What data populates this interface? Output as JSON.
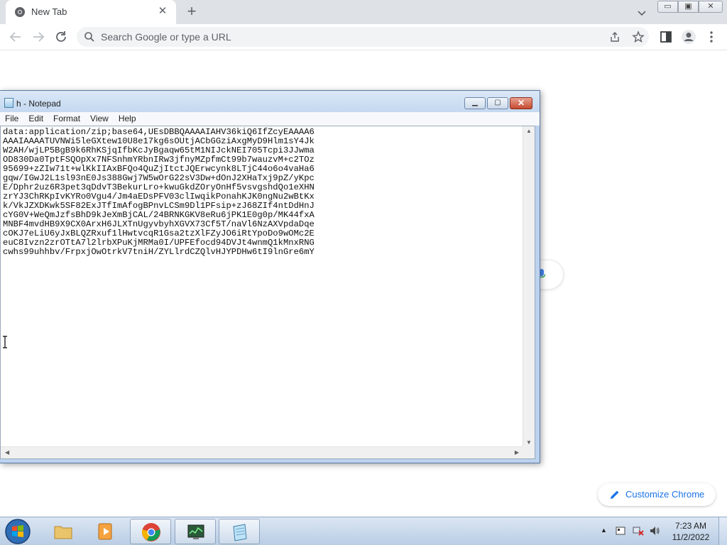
{
  "browser": {
    "tab_title": "New Tab",
    "tab_close": "✕",
    "new_tab_label": "+",
    "omnibox_placeholder": "Search Google or type a URL",
    "customize_label": "Customize Chrome"
  },
  "window_controls": {
    "minimize": "▭",
    "restore": "▣",
    "close": "✕"
  },
  "notepad": {
    "title": "h - Notepad",
    "menu": [
      "File",
      "Edit",
      "Format",
      "View",
      "Help"
    ],
    "content": "data:application/zip;base64,UEsDBBQAAAAIAHV36kiQ6IfZcyEAAAA6\nAAAIAAAATUVNWi5leGXtew10U8e17kg6sOUtjACbGGziAxgMyD9Hlm1sY4Jk\nW2AH/wjLP5BgB9k6RhKSjqIfbKcJyBgaqw65tM1NIJckNEI705Tcpi3JJwma\nOD830Da0TptFSQOpXx7NFSnhmYRbnIRw3jfnyMZpfmCt99b7wauzvM+c2TOz\n95699+zZIw71t+wlKkIIAxBFQo4QuZjItctJQErwcynk8LTjC44o6o4vaHa6\ngqw/IGwJ2L1sl93nE0Js388Gwj7W5wOrG22sV3Dw+dOnJ2XHaTxj9pZ/yKpc\nE/Dphr2uz6R3pet3qDdvT3BekurLro+kwuGkdZOryOnHf5vsvgshdQo1eXHN\nzrYJ3ChRKpIvKYRo0Vgu4/Jm4aEDsPFV03clIwqikPonahKJK0ngNu2wBtKx\nk/VkJZXDKwk5SF82ExJTfImAfogBPnvLCSm9Dl1PFsip+zJ68ZIf4ntDdHnJ\ncYG0V+WeQmJzfsBhD9kJeXmBjCAL/24BRNKGKV8eRu6jPK1E0g0p/MK44fxA\nMNBF4mvdHB9X9CX0ArxH6JLXTnUgyvbyhXGVX73Cf5T/naVl6NzAXVpdaDqe\ncOKJ7eLiU6yJxBLQZRxuf1lHwtvcqR1Gsa2tzXlFZyJO6iRtYpoDo9wOMc2E\neuC8Ivzn2zrOTtA7l2lrbXPuKjMRMa0I/UPFEfocd94DVJt4wnmQ1kMnxRNG\ncwhs99uhhbv/FrpxjOwOtrkV7tniH/ZYLlrdCZQlvHJYPDHw6tI9lnGre6mY"
  },
  "taskbar": {
    "time": "7:23 AM",
    "date": "11/2/2022"
  },
  "colors": {
    "chrome_tabstrip": "#dee1e6",
    "notepad_frame": "#bcd2ee",
    "taskbar": "#c4d5ea",
    "accent": "#1a73e8"
  }
}
